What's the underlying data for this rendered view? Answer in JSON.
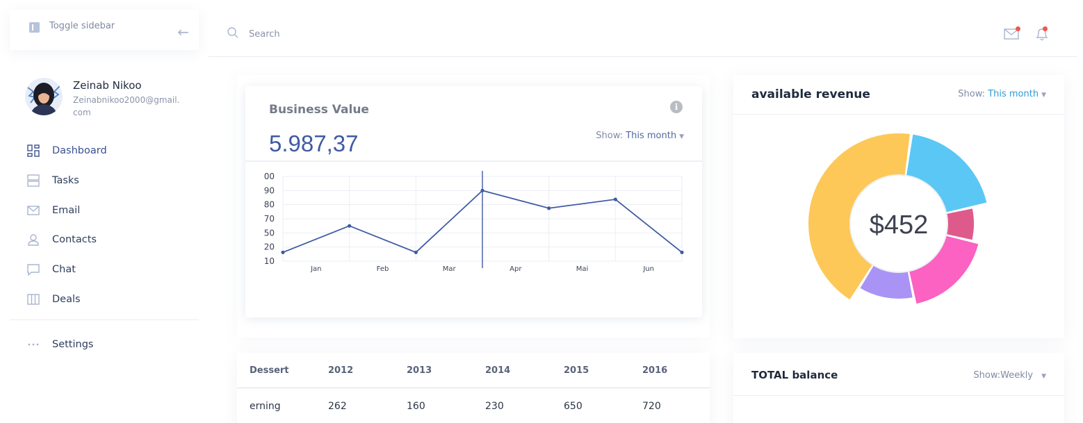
{
  "sidebar": {
    "toggle_label": "Toggle sidebar",
    "profile": {
      "name": "Zeinab Nikoo",
      "email": "Zeinabnikoo2000@gmail.\ncom"
    },
    "items": [
      {
        "label": "Dashboard",
        "icon": "grid-icon"
      },
      {
        "label": "Tasks",
        "icon": "tasks-icon"
      },
      {
        "label": "Email",
        "icon": "mail-icon"
      },
      {
        "label": "Contacts",
        "icon": "user-icon"
      },
      {
        "label": "Chat",
        "icon": "chat-icon"
      },
      {
        "label": "Deals",
        "icon": "columns-icon"
      }
    ],
    "settings_label": "Settings"
  },
  "header": {
    "search_placeholder": "Search",
    "icons": [
      "mail-icon",
      "bell-icon"
    ],
    "notification_color": "#f2564b"
  },
  "business_value": {
    "title": "Business Value",
    "info_icon": "i",
    "value": "5.987,37",
    "show_label": "Show: ",
    "show_value": "This month"
  },
  "revenue": {
    "title": "available revenue",
    "show_label": "Show: ",
    "show_value": "This month",
    "center_value": "$452"
  },
  "table": {
    "headers": [
      "Dessert",
      "2012",
      "2013",
      "2014",
      "2015",
      "2016"
    ],
    "rows": [
      [
        "erning",
        "262",
        "160",
        "230",
        "650",
        "720"
      ]
    ]
  },
  "balance": {
    "title": "TOTAL balance",
    "show_label": "Show:Weekly"
  },
  "chart_data": [
    {
      "type": "line",
      "categories": [
        "Jan",
        "Feb",
        "Mar",
        "Apr",
        "Mai",
        "Jun"
      ],
      "y_ticks": [
        "00",
        "90",
        "80",
        "70",
        "50",
        "20",
        "10"
      ],
      "points": [
        {
          "x": 0.0,
          "y": 20
        },
        {
          "x": 1.0,
          "y": 50
        },
        {
          "x": 2.0,
          "y": 20
        },
        {
          "x": 3.0,
          "y": 90
        },
        {
          "x": 4.0,
          "y": 70
        },
        {
          "x": 5.0,
          "y": 80
        },
        {
          "x": 6.0,
          "y": 20
        }
      ],
      "cursor_x": 3.0,
      "color": "#3f5aa4",
      "grid": true
    },
    {
      "type": "pie",
      "center_label": "$452",
      "slices": [
        {
          "value": 16,
          "color": "#5bc7f5",
          "outer": "large"
        },
        {
          "value": 6,
          "color": "#de5a8b",
          "outer": "small"
        },
        {
          "value": 15,
          "color": "#fb62c1",
          "outer": "medium"
        },
        {
          "value": 10,
          "color": "#a993f5",
          "outer": "small"
        },
        {
          "value": 36,
          "color": "#fdc857",
          "outer": "large"
        }
      ]
    }
  ]
}
